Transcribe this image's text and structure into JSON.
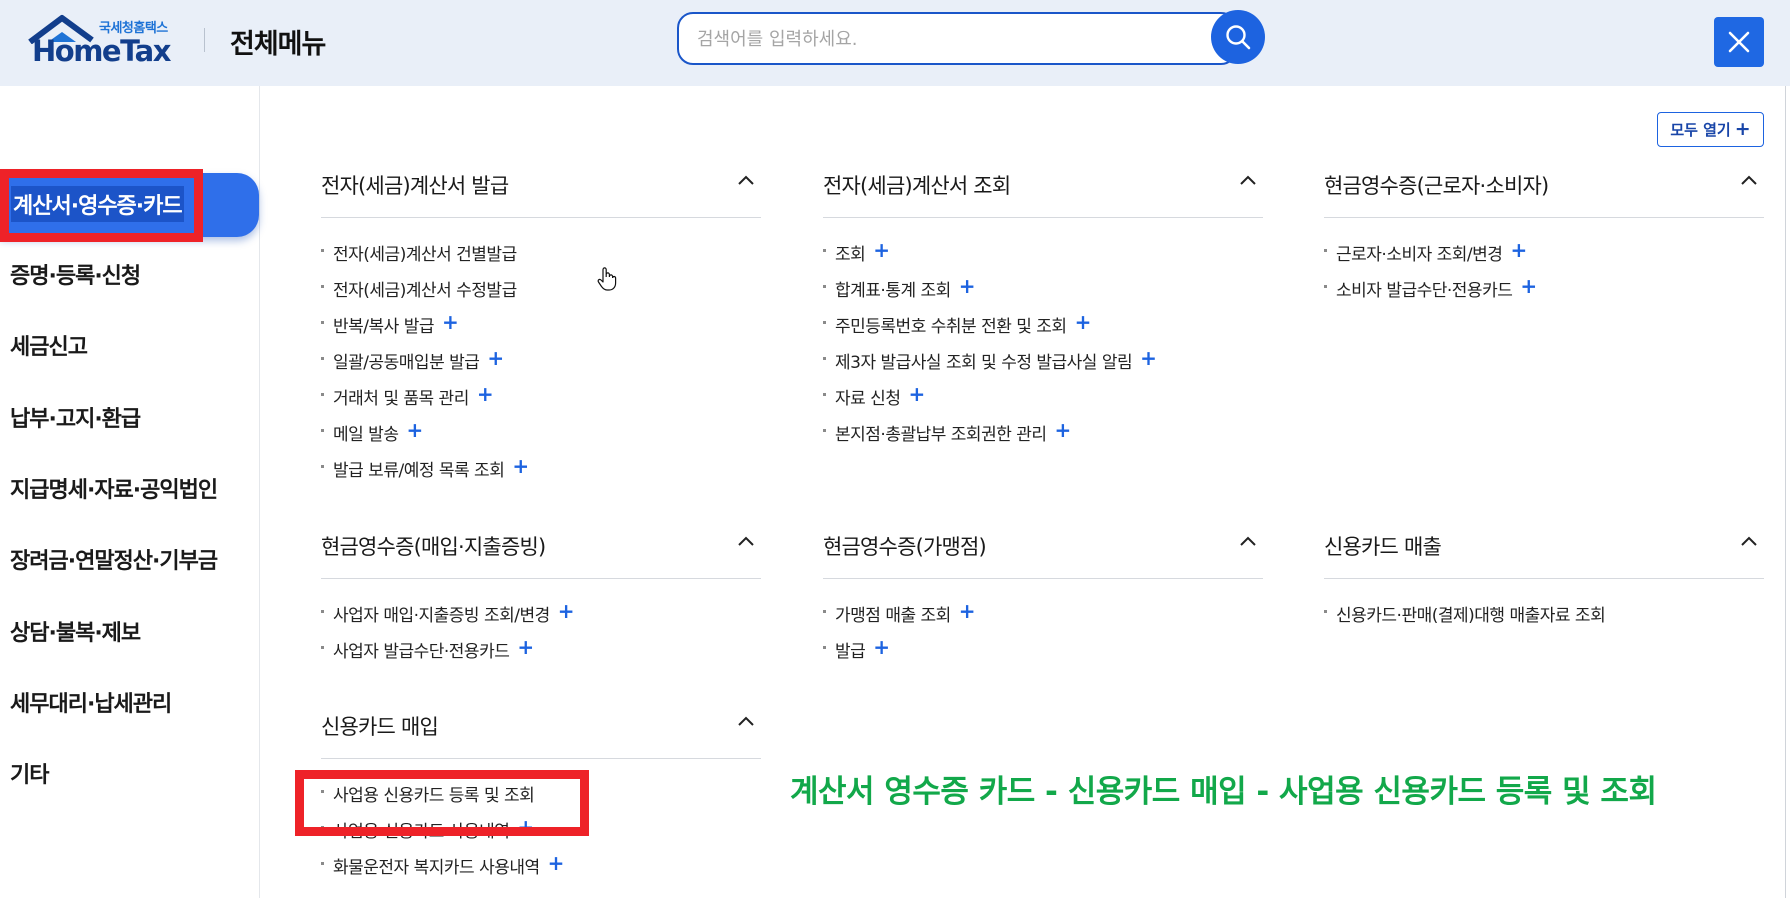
{
  "header": {
    "logo_small": "국세청홈택스",
    "logo_main": "HomeTax",
    "title": "전체메뉴",
    "search_placeholder": "검색어를 입력하세요.",
    "expand_all_label": "모두 열기"
  },
  "sidebar": {
    "items": [
      {
        "label": "계산서·영수증·카드",
        "active": true
      },
      {
        "label": "증명·등록·신청"
      },
      {
        "label": "세금신고"
      },
      {
        "label": "납부·고지·환급"
      },
      {
        "label": "지급명세·자료·공익법인"
      },
      {
        "label": "장려금·연말정산·기부금"
      },
      {
        "label": "상담·불복·제보"
      },
      {
        "label": "세무대리·납세관리"
      },
      {
        "label": "기타"
      }
    ]
  },
  "sections": [
    {
      "title": "전자(세금)계산서 발급",
      "items": [
        {
          "label": "전자(세금)계산서 건별발급",
          "expandable": false
        },
        {
          "label": "전자(세금)계산서 수정발급",
          "expandable": false
        },
        {
          "label": "반복/복사 발급",
          "expandable": true
        },
        {
          "label": "일괄/공동매입분 발급",
          "expandable": true
        },
        {
          "label": "거래처 및 품목 관리",
          "expandable": true
        },
        {
          "label": "메일 발송",
          "expandable": true
        },
        {
          "label": "발급 보류/예정 목록 조회",
          "expandable": true
        }
      ]
    },
    {
      "title": "전자(세금)계산서 조회",
      "items": [
        {
          "label": "조회",
          "expandable": true
        },
        {
          "label": "합계표·통계 조회",
          "expandable": true
        },
        {
          "label": "주민등록번호 수취분 전환 및 조회",
          "expandable": true
        },
        {
          "label": "제3자 발급사실 조회 및 수정 발급사실 알림",
          "expandable": true
        },
        {
          "label": "자료 신청",
          "expandable": true
        },
        {
          "label": "본지점·총괄납부 조회권한 관리",
          "expandable": true
        }
      ]
    },
    {
      "title": "현금영수증(근로자·소비자)",
      "items": [
        {
          "label": "근로자·소비자 조회/변경",
          "expandable": true
        },
        {
          "label": "소비자 발급수단·전용카드",
          "expandable": true
        }
      ]
    },
    {
      "title": "현금영수증(매입·지출증빙)",
      "items": [
        {
          "label": "사업자 매입·지출증빙 조회/변경",
          "expandable": true
        },
        {
          "label": "사업자 발급수단·전용카드",
          "expandable": true
        }
      ]
    },
    {
      "title": "현금영수증(가맹점)",
      "items": [
        {
          "label": "가맹점 매출 조회",
          "expandable": true
        },
        {
          "label": "발급",
          "expandable": true
        }
      ]
    },
    {
      "title": "신용카드 매출",
      "items": [
        {
          "label": "신용카드·판매(결제)대행 매출자료 조회",
          "expandable": false
        }
      ]
    },
    {
      "title": "신용카드 매입",
      "items": [
        {
          "label": "사업용 신용카드 등록 및 조회",
          "expandable": false
        },
        {
          "label": "사업용 신용카드 사용내역",
          "expandable": true
        },
        {
          "label": "화물운전자 복지카드 사용내역",
          "expandable": true
        }
      ]
    }
  ],
  "annotation": "계산서 영수증 카드 - 신용카드 매입 - 사업용 신용카드 등록 및 조회",
  "colors": {
    "accent": "#1d63e0",
    "highlight_box": "#ee2228",
    "annotation_text": "#12a84a",
    "header_bg": "#e9eff8"
  },
  "icons": [
    "search-icon",
    "close-icon",
    "chevron-up-icon",
    "plus-icon",
    "cursor-hand-icon"
  ]
}
